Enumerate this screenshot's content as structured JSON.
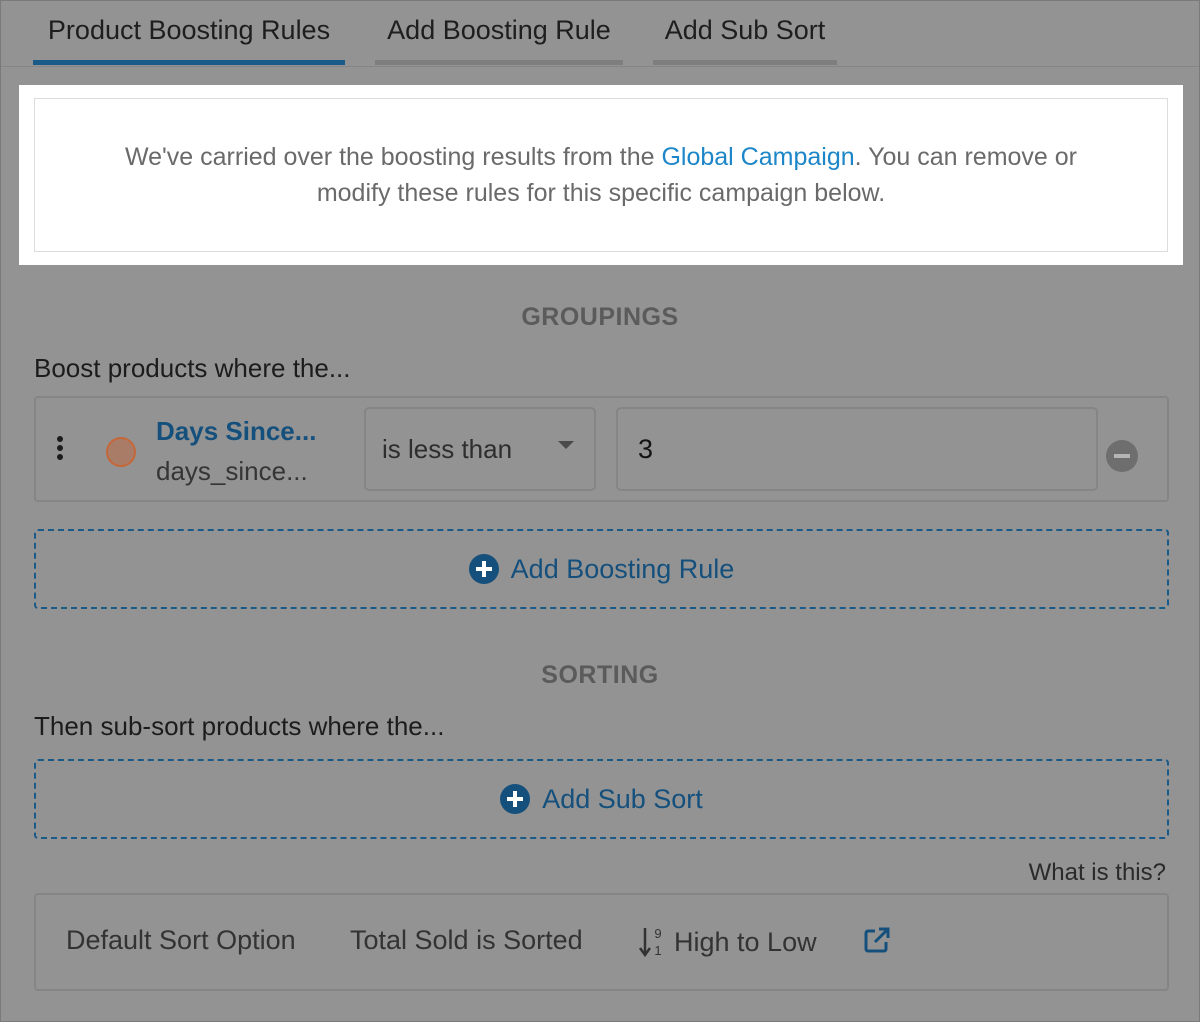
{
  "tabs": [
    {
      "label": "Product Boosting Rules",
      "active": true
    },
    {
      "label": "Add Boosting Rule",
      "active": false
    },
    {
      "label": "Add Sub Sort",
      "active": false
    }
  ],
  "notice": {
    "text_before": "We've carried over the boosting results from the ",
    "link": "Global Campaign",
    "text_after": ". You can remove or modify these rules for this specific campaign below."
  },
  "groupings": {
    "title": "GROUPINGS",
    "lead": "Boost products where the...",
    "rule": {
      "field_name": "Days Since...",
      "field_key": "days_since...",
      "operator": "is less than",
      "value": "3",
      "color": "#a87c66"
    },
    "add_label": "Add Boosting Rule"
  },
  "sorting": {
    "title": "SORTING",
    "lead": "Then sub-sort products where the...",
    "add_label": "Add Sub Sort",
    "help_link": "What is this?",
    "default_sort": {
      "label": "Default Sort Option",
      "value": "Total Sold is Sorted",
      "order": "High to Low",
      "order_icon": "sort-numeric-desc-icon",
      "link_icon": "external-link-icon"
    }
  },
  "colors": {
    "accent": "#1a5a88",
    "link": "#1c86c8"
  }
}
